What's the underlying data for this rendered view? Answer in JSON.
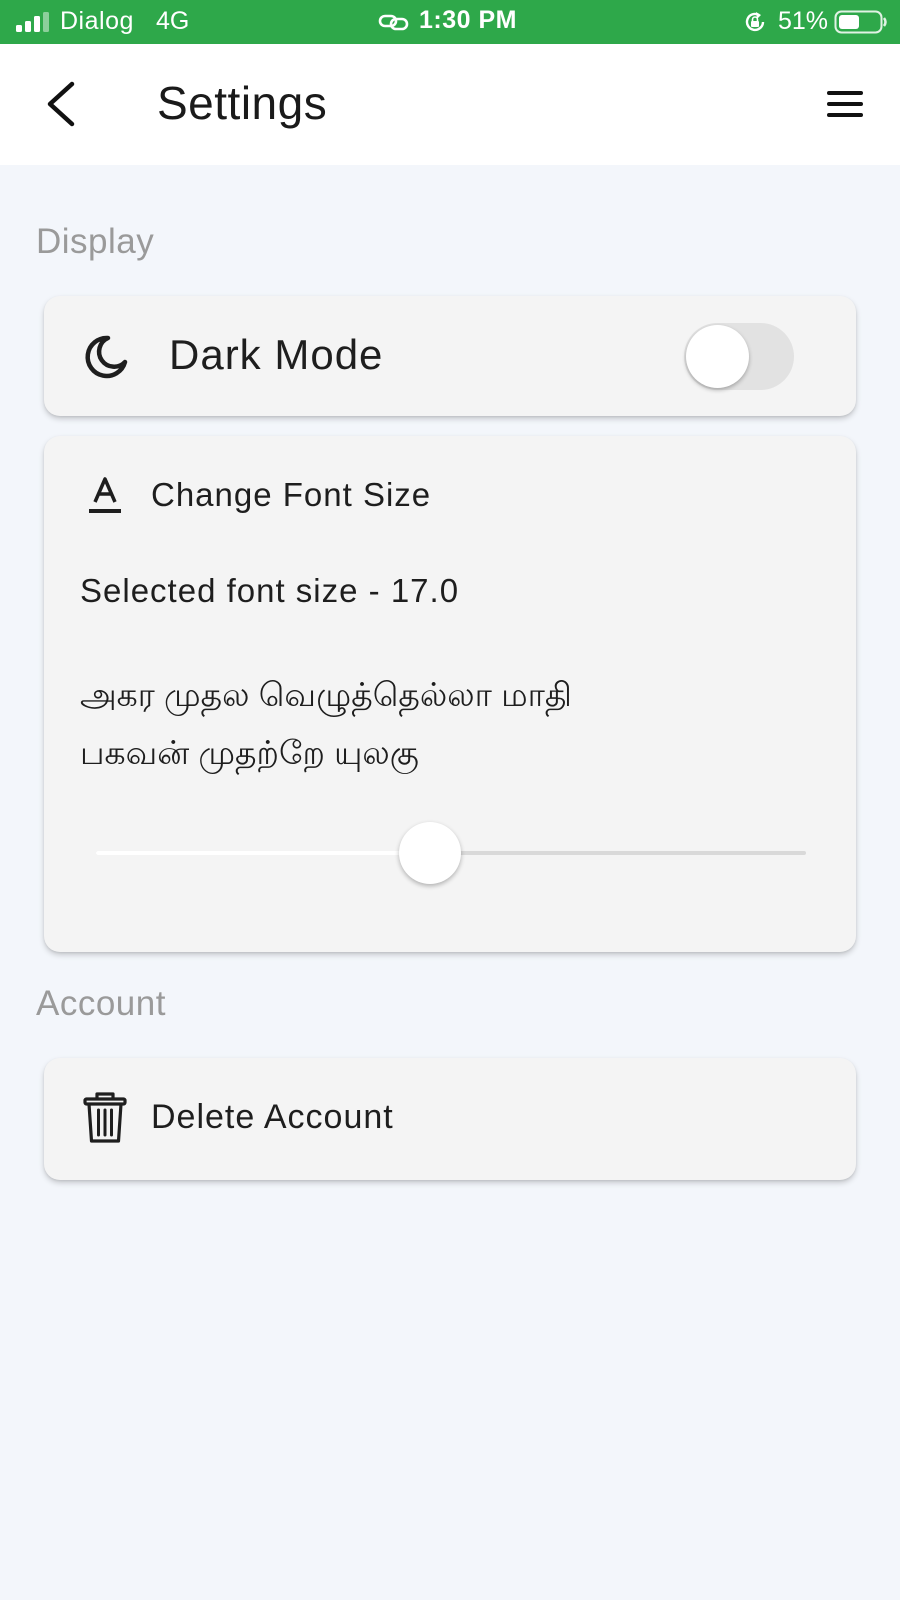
{
  "status_bar": {
    "carrier": "Dialog",
    "network": "4G",
    "time": "1:30 PM",
    "battery_percent_label": "51%",
    "battery_level": 0.51,
    "signal_bars": 3,
    "background_color": "#2ea84a"
  },
  "app_bar": {
    "title": "Settings",
    "back_icon": "chevron-left-icon",
    "menu_icon": "hamburger-menu-icon"
  },
  "display_section": {
    "header": "Display",
    "dark_mode": {
      "icon": "moon-icon",
      "label": "Dark Mode",
      "enabled": false
    },
    "font_size": {
      "icon": "text-format-icon",
      "title": "Change Font Size",
      "selected_text": "Selected font size - 17.0",
      "sample_lines": [
        "அகர முதல வெழுத்தெல்லா மாதி",
        "பகவன் முதற்றே யுலகு"
      ],
      "slider_fraction": 0.47
    }
  },
  "account_section": {
    "header": "Account",
    "delete_account": {
      "icon": "trash-icon",
      "label": "Delete Account"
    }
  }
}
